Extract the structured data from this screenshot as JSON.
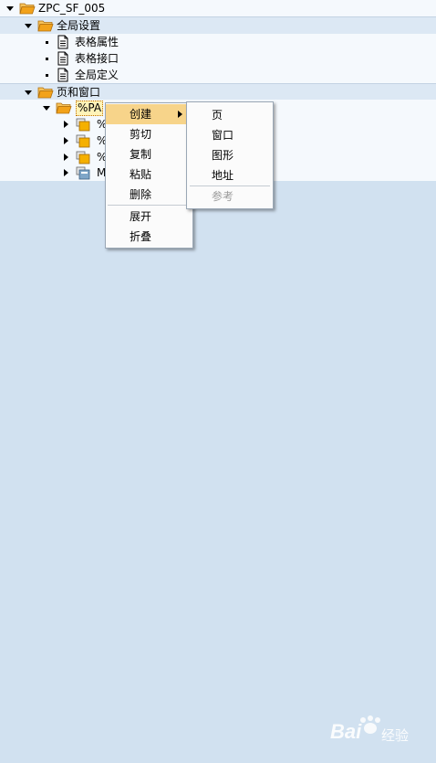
{
  "tree": {
    "root": {
      "label": "ZPC_SF_005"
    },
    "global_settings": {
      "label": "全局设置",
      "children": [
        {
          "label": "表格属性"
        },
        {
          "label": "表格接口"
        },
        {
          "label": "全局定义"
        }
      ]
    },
    "pages_windows": {
      "label": "页和窗口",
      "selected": {
        "label": "%PA"
      },
      "children": [
        {
          "label": "%"
        },
        {
          "label": "%"
        },
        {
          "label": "%"
        },
        {
          "label": "M"
        }
      ]
    }
  },
  "context_menu": {
    "items": [
      {
        "label": "创建",
        "has_submenu": true,
        "highlighted": true
      },
      {
        "label": "剪切"
      },
      {
        "label": "复制"
      },
      {
        "label": "粘贴"
      },
      {
        "label": "删除"
      },
      {
        "label": "展开"
      },
      {
        "label": "折叠"
      }
    ]
  },
  "submenu": {
    "items": [
      {
        "label": "页"
      },
      {
        "label": "窗口"
      },
      {
        "label": "图形"
      },
      {
        "label": "地址"
      },
      {
        "label": "参考",
        "disabled": true
      }
    ]
  },
  "watermark": {
    "text": "Bai",
    "suffix": "经验"
  },
  "colors": {
    "background": "#d1e1f0",
    "folder": "#f2a21a",
    "menu_highlight": "#f7d48a",
    "selection": "#fff3b8"
  },
  "icons": [
    "folder-open-icon",
    "document-icon",
    "window-icon",
    "graphic-icon"
  ]
}
